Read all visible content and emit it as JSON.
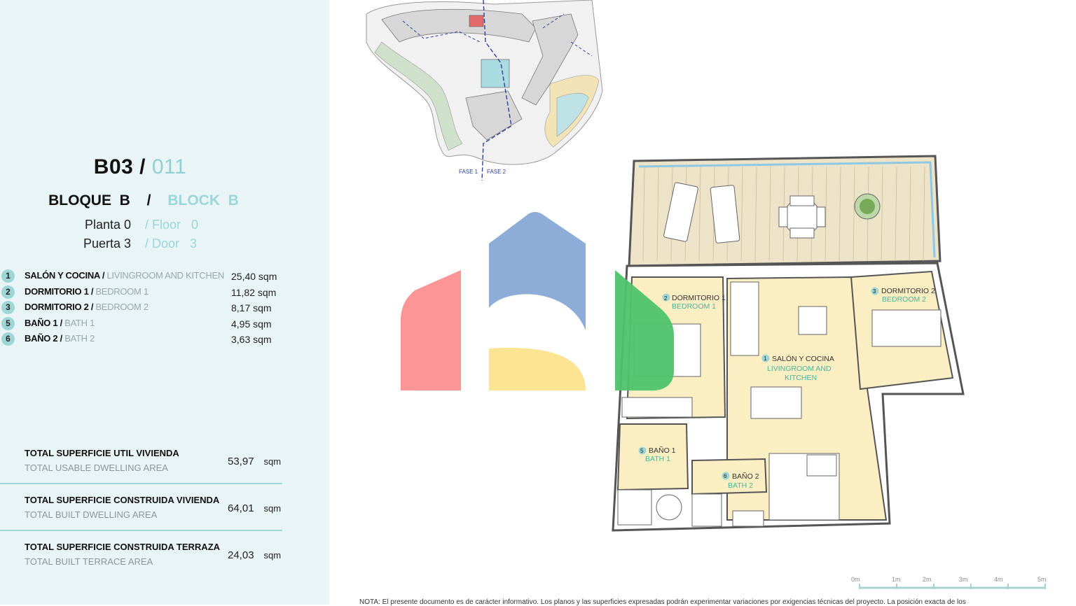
{
  "unit": {
    "code": "B03 /",
    "code_light": "011"
  },
  "block": {
    "es": "BLOQUE  B",
    "sep": "/",
    "en": "BLOCK  B"
  },
  "floor": {
    "es": "Planta 0",
    "en": "/ Floor   0"
  },
  "door": {
    "es": "Puerta 3",
    "en": "/ Door   3"
  },
  "rooms": [
    {
      "num": "1",
      "es": "SALÓN Y COCINA /",
      "en": "LIVINGROOM AND KITCHEN",
      "area": "25,40 sqm"
    },
    {
      "num": "2",
      "es": "DORMITORIO 1 /",
      "en": "BEDROOM 1",
      "area": "11,82 sqm"
    },
    {
      "num": "3",
      "es": "DORMITORIO 2 /",
      "en": "BEDROOM 2",
      "area": "8,17 sqm"
    },
    {
      "num": "5",
      "es": "BAÑO 1 /",
      "en": "BATH 1",
      "area": "4,95 sqm"
    },
    {
      "num": "6",
      "es": "BAÑO 2 /",
      "en": "BATH 2",
      "area": "3,63 sqm"
    }
  ],
  "totals": [
    {
      "es": "TOTAL SUPERFICIE UTIL VIVIENDA",
      "en": "TOTAL USABLE DWELLING AREA",
      "value": "53,97",
      "unit": "sqm"
    },
    {
      "es": "TOTAL SUPERFICIE CONSTRUIDA VIVIENDA",
      "en": "TOTAL BUILT DWELLING AREA",
      "value": "64,01",
      "unit": "sqm"
    },
    {
      "es": "TOTAL SUPERFICIE CONSTRUIDA TERRAZA",
      "en": "TOTAL BUILT TERRACE AREA",
      "value": "24,03",
      "unit": "sqm"
    }
  ],
  "siteplan": {
    "phase1": "FASE 1",
    "phase2": "FASE 2"
  },
  "plan_labels": {
    "bed1_num": "2",
    "bed1_es": "DORMITORIO 1",
    "bed1_en": "BEDROOM 1",
    "bed2_num": "3",
    "bed2_es": "DORMITORIO 2",
    "bed2_en": "BEDROOM 2",
    "living_num": "1",
    "living_es": "SALÓN Y COCINA",
    "living_en1": "LIVINGROOM AND",
    "living_en2": "KITCHEN",
    "bath1_num": "5",
    "bath1_es": "BAÑO 1",
    "bath1_en": "BATH 1",
    "bath2_num": "6",
    "bath2_es": "BAÑO 2",
    "bath2_en": "BATH 2"
  },
  "scale": [
    "0m",
    "1m",
    "2m",
    "3m",
    "4m",
    "5m"
  ],
  "footnote": "NOTA: El presente documento es de carácter informativo. Los planos y las superficies expresadas podrán experimentar variaciones por exigencias técnicas del proyecto. La posición exacta de los",
  "colors": {
    "sidebar_bg": "#e8f4f6",
    "accent": "#9ed5d5",
    "room_fill": "#fbeec3",
    "terrace_fill": "#ece2c8",
    "logo_red": "#fc8f8f",
    "logo_blue": "#87a8d6",
    "logo_yellow": "#fde38d",
    "logo_green": "#4fc26b"
  }
}
